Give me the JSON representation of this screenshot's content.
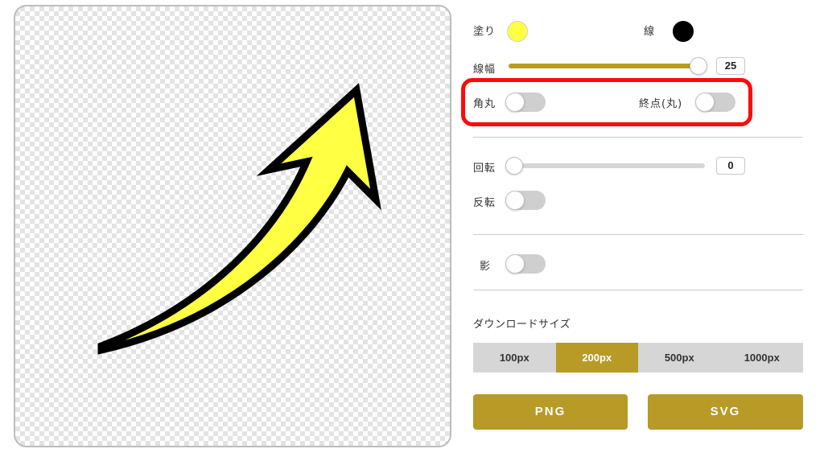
{
  "fill": {
    "label": "塗り",
    "color": "#ffff44"
  },
  "stroke": {
    "label": "線",
    "color": "#000000"
  },
  "stroke_width": {
    "label": "線幅",
    "value": "25"
  },
  "round_corner": {
    "label": "角丸",
    "on": false
  },
  "round_end": {
    "label": "終点(丸)",
    "on": false
  },
  "rotation": {
    "label": "回転",
    "value": "0"
  },
  "flip": {
    "label": "反転",
    "on": false
  },
  "shadow": {
    "label": "影",
    "on": false
  },
  "download": {
    "title": "ダウンロードサイズ",
    "sizes": [
      "100px",
      "200px",
      "500px",
      "1000px"
    ],
    "selected": "200px",
    "png_label": "PNG",
    "svg_label": "SVG"
  },
  "colors": {
    "accent": "#b89a26",
    "highlight": "#ff0a0a",
    "arrow_fill": "#ffff44",
    "arrow_stroke": "#000000"
  }
}
